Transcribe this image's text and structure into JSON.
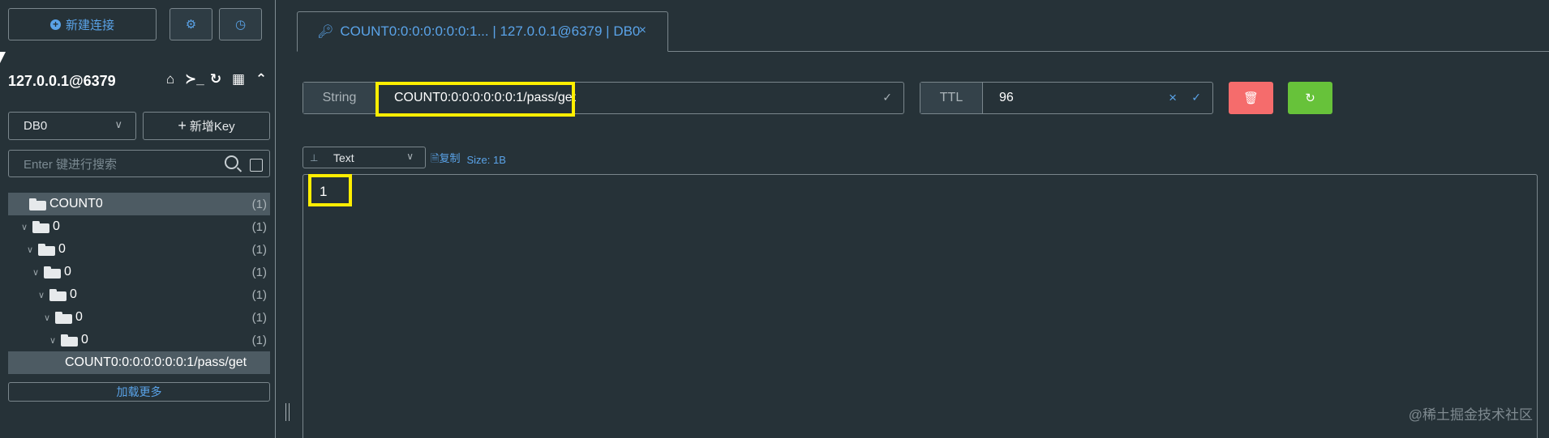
{
  "sidebar": {
    "new_connection_label": "新建连接",
    "settings_icon": "gear-icon",
    "history_icon": "clock-icon",
    "connection_title": "127.0.0.1@6379",
    "db_select": "DB0",
    "new_key_label": "新增Key",
    "search_placeholder": "Enter 键进行搜索",
    "tree": [
      {
        "label": "COUNT0",
        "count": "(1)",
        "depth": 0
      },
      {
        "label": "0",
        "count": "(1)",
        "depth": 1
      },
      {
        "label": "0",
        "count": "(1)",
        "depth": 2
      },
      {
        "label": "0",
        "count": "(1)",
        "depth": 3
      },
      {
        "label": "0",
        "count": "(1)",
        "depth": 4
      },
      {
        "label": "0",
        "count": "(1)",
        "depth": 5
      },
      {
        "label": "0",
        "count": "(1)",
        "depth": 6
      },
      {
        "label": "COUNT0:0:0:0:0:0:0:1/pass/get",
        "count": "",
        "depth": 7
      }
    ],
    "load_more_label": "加载更多"
  },
  "tab": {
    "title": "COUNT0:0:0:0:0:0:0:1... | 127.0.0.1@6379 | DB0",
    "close": "×"
  },
  "key": {
    "type": "String",
    "name": "COUNT0:0:0:0:0:0:0:1/pass/get"
  },
  "ttl": {
    "label": "TTL",
    "value": "96"
  },
  "viewer": {
    "format": "Text",
    "copy_label": "复制",
    "size_label": "Size: 1B",
    "content": "1"
  },
  "watermark": "@稀土掘金技术社区",
  "colors": {
    "background": "#263238",
    "accent": "#5aa3e8",
    "delete": "#f56c6c",
    "refresh": "#67c23a",
    "highlight": "#ffee00"
  }
}
